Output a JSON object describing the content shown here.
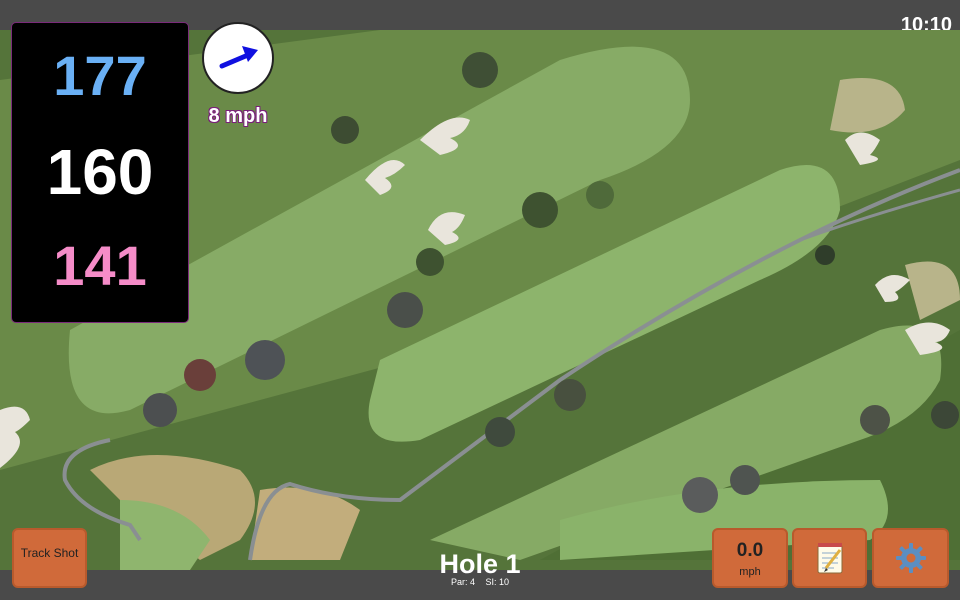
{
  "status_bar": {
    "time": "10:10"
  },
  "distances": {
    "back": "177",
    "middle": "160",
    "front": "141",
    "colors": {
      "back": "#6ab0f5",
      "middle": "#ffffff",
      "front": "#f58cc8"
    }
  },
  "wind": {
    "speed_label": "8 mph",
    "arrow_icon": "wind-direction-arrow",
    "arrow_color": "#1010e0"
  },
  "buttons": {
    "track_shot": "Track Shot",
    "speed_value": "0.0",
    "speed_unit": "mph",
    "notes_icon": "notepad-icon",
    "settings_icon": "gear-icon",
    "accent": "#d06a3a"
  },
  "hole": {
    "title": "Hole 1",
    "par": "Par: 4",
    "si": "SI: 10"
  }
}
